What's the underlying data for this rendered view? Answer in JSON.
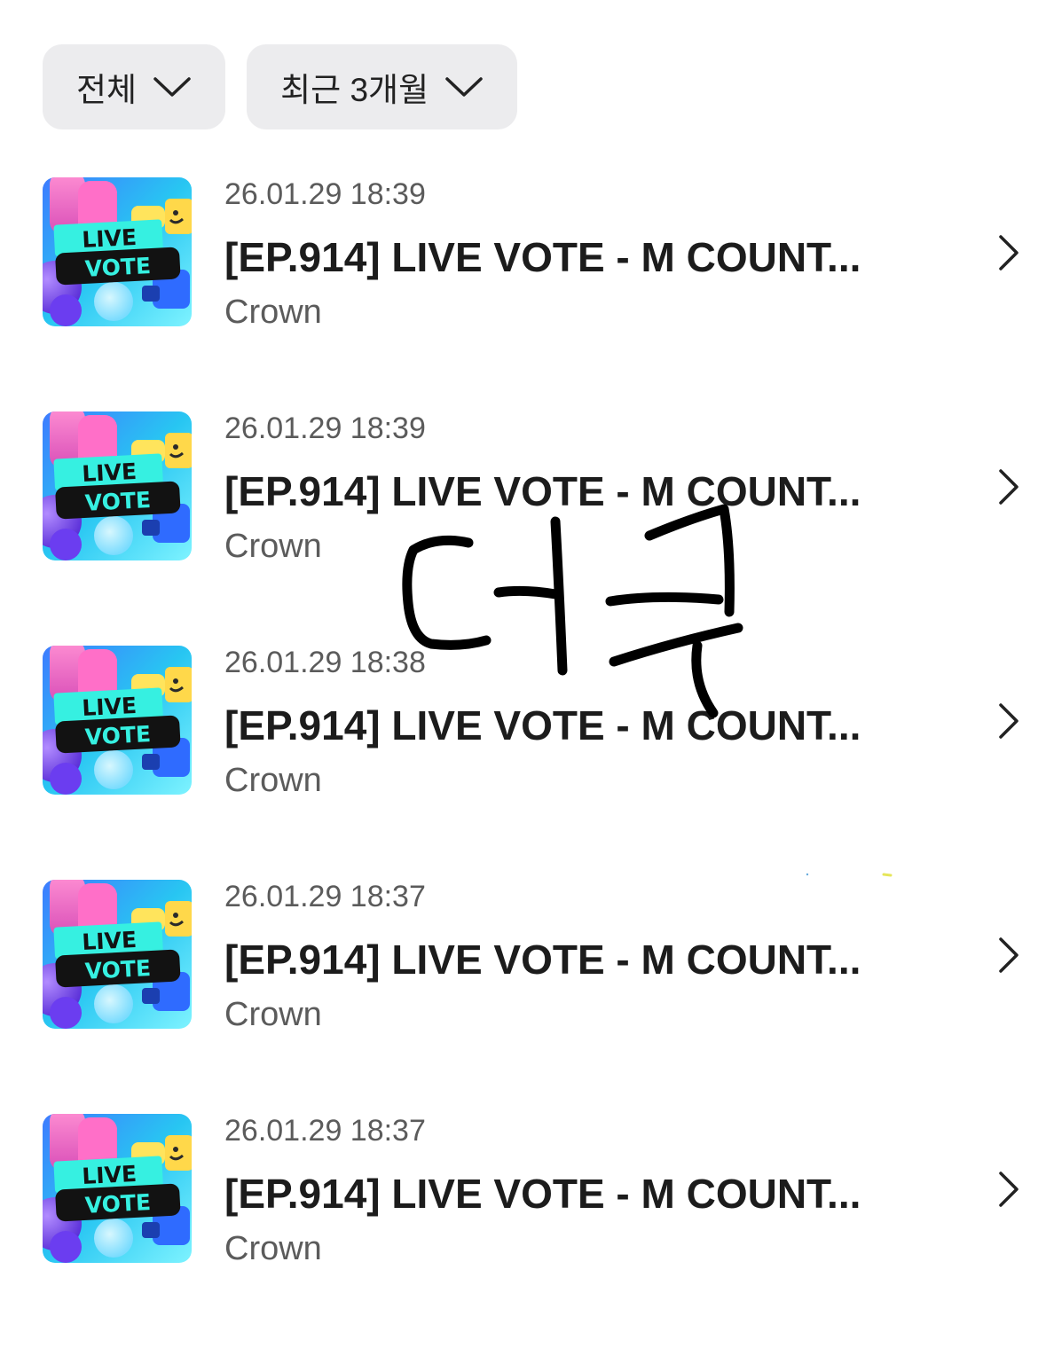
{
  "filters": [
    {
      "label": "전체"
    },
    {
      "label": "최근 3개월"
    }
  ],
  "thumbnail": {
    "line1": "LIVE",
    "line2": "VOTE"
  },
  "items": [
    {
      "date": "26.01.29 18:39",
      "title": "[EP.914] LIVE VOTE - M COUNT...",
      "subtitle": "Crown"
    },
    {
      "date": "26.01.29 18:39",
      "title": "[EP.914] LIVE VOTE - M COUNT...",
      "subtitle": "Crown"
    },
    {
      "date": "26.01.29 18:38",
      "title": "[EP.914] LIVE VOTE - M COUNT...",
      "subtitle": "Crown"
    },
    {
      "date": "26.01.29 18:37",
      "title": "[EP.914] LIVE VOTE - M COUNT...",
      "subtitle": "Crown"
    },
    {
      "date": "26.01.29 18:37",
      "title": "[EP.914] LIVE VOTE - M COUNT...",
      "subtitle": "Crown"
    }
  ],
  "overlay": {
    "handwriting": "더쿠"
  }
}
